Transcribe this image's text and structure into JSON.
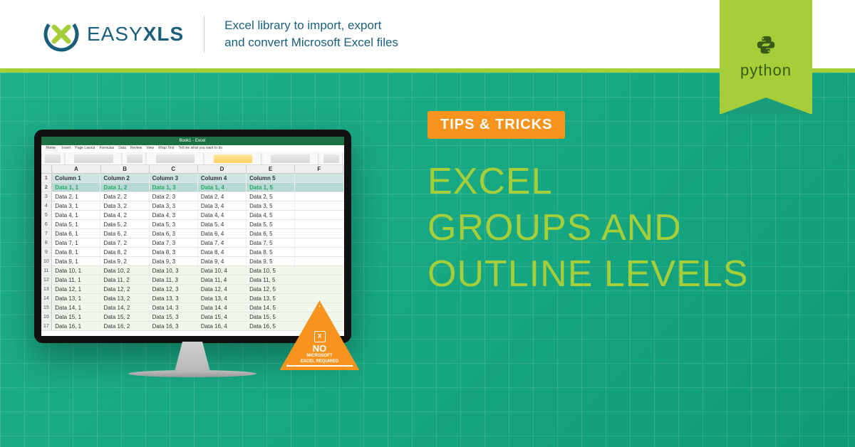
{
  "header": {
    "logo_prefix": "EASY",
    "logo_suffix": "XLS",
    "tagline_line1": "Excel library to import, export",
    "tagline_line2": "and convert Microsoft Excel files"
  },
  "ribbon": {
    "lang": "python"
  },
  "excel": {
    "title": "Book1 - Excel",
    "tabs": [
      "Home",
      "Insert",
      "Page Layout",
      "Formulas",
      "Data",
      "Review",
      "View",
      "Wrap Text",
      "Tell me what you want to do"
    ],
    "col_letters": [
      "A",
      "B",
      "C",
      "D",
      "E",
      "F"
    ],
    "headers": [
      "Column 1",
      "Column 2",
      "Column 3",
      "Column 4",
      "Column 5"
    ],
    "rows": [
      [
        "Data 1, 1",
        "Data 1, 2",
        "Data 1, 3",
        "Data 1, 4",
        "Data 1, 5"
      ],
      [
        "Data 2, 1",
        "Data 2, 2",
        "Data 2, 3",
        "Data 2, 4",
        "Data 2, 5"
      ],
      [
        "Data 3, 1",
        "Data 3, 2",
        "Data 3, 3",
        "Data 3, 4",
        "Data 3, 5"
      ],
      [
        "Data 4, 1",
        "Data 4, 2",
        "Data 4, 3",
        "Data 4, 4",
        "Data 4, 5"
      ],
      [
        "Data 5, 1",
        "Data 5, 2",
        "Data 5, 3",
        "Data 5, 4",
        "Data 5, 5"
      ],
      [
        "Data 6, 1",
        "Data 6, 2",
        "Data 6, 3",
        "Data 6, 4",
        "Data 6, 5"
      ],
      [
        "Data 7, 1",
        "Data 7, 2",
        "Data 7, 3",
        "Data 7, 4",
        "Data 7, 5"
      ],
      [
        "Data 8, 1",
        "Data 8, 2",
        "Data 8, 3",
        "Data 8, 4",
        "Data 8, 5"
      ],
      [
        "Data 9, 1",
        "Data 9, 2",
        "Data 9, 3",
        "Data 9, 4",
        "Data 9, 5"
      ],
      [
        "Data 10, 1",
        "Data 10, 2",
        "Data 10, 3",
        "Data 10, 4",
        "Data 10, 5"
      ],
      [
        "Data 11, 1",
        "Data 11, 2",
        "Data 11, 3",
        "Data 11, 4",
        "Data 11, 5"
      ],
      [
        "Data 12, 1",
        "Data 12, 2",
        "Data 12, 3",
        "Data 12, 4",
        "Data 12, 5"
      ],
      [
        "Data 13, 1",
        "Data 13, 2",
        "Data 13, 3",
        "Data 13, 4",
        "Data 13, 5"
      ],
      [
        "Data 14, 1",
        "Data 14, 2",
        "Data 14, 3",
        "Data 14, 4",
        "Data 14, 5"
      ],
      [
        "Data 15, 1",
        "Data 15, 2",
        "Data 15, 3",
        "Data 15, 4",
        "Data 15, 5"
      ],
      [
        "Data 16, 1",
        "Data 16, 2",
        "Data 16, 3",
        "Data 16, 4",
        "Data 16, 5"
      ]
    ]
  },
  "warning": {
    "icon_letter": "X",
    "line1": "NO",
    "line2": "MICROSOFT",
    "line3": "EXCEL REQUIRED"
  },
  "tips_label": "TIPS & TRICKS",
  "title_line1": "EXCEL",
  "title_line2": "GROUPS AND",
  "title_line3": "OUTLINE LEVELS"
}
